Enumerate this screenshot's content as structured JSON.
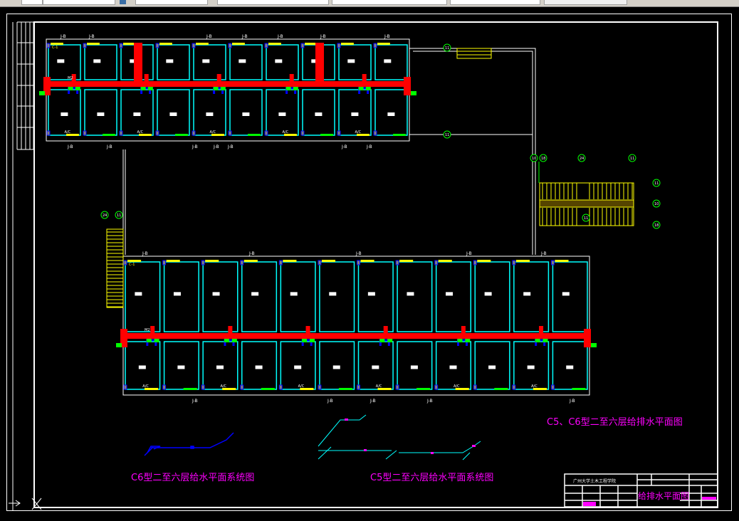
{
  "viewer": {
    "toolbar_icons": [
      "print-icon",
      "save-icon"
    ]
  },
  "drawing": {
    "main_title": "C5、C6型二至六层给排水平面图",
    "system_title_c6": "C6型二至六层给水平面系统图",
    "system_title_c5": "C5型二至六层给水平面系统图",
    "room_labels": [
      "J-B",
      "J-B",
      "J-B",
      "J-B",
      "J-B",
      "J-B",
      "J-B",
      "J-B",
      "J-B",
      "J-B"
    ],
    "ac_label": "A/C",
    "window_label": "C-1",
    "door_label": "M2",
    "axis_markers": [
      "11",
      "11",
      "10",
      "18",
      "24"
    ]
  },
  "title_block": {
    "school": "广州大学土木工程学院",
    "drawing_name": "给排水平面图"
  },
  "colors": {
    "background": "#000000",
    "wall": "#00ffff",
    "frame": "#ffffff",
    "drain_pipe": "#ff0000",
    "supply_pipe": "#0000ff",
    "fixture": "#00ff00",
    "window": "#ffff00",
    "text_title": "#ff00ff"
  }
}
